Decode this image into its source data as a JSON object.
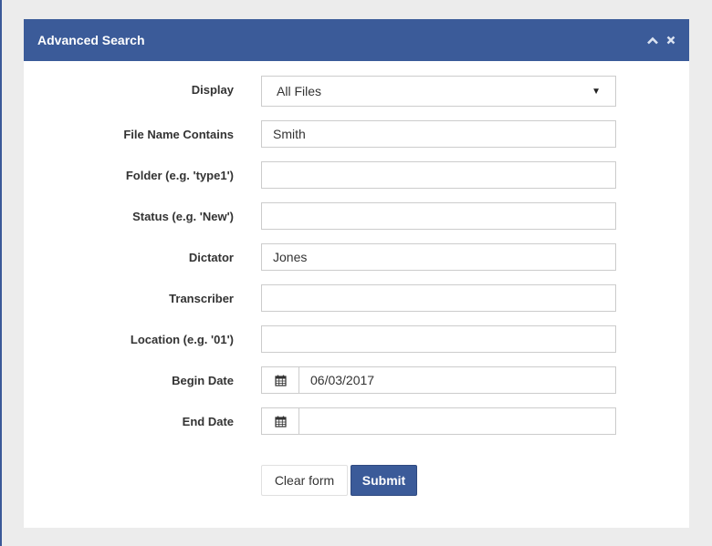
{
  "panel": {
    "title": "Advanced Search"
  },
  "fields": {
    "display": {
      "label": "Display",
      "value": "All Files"
    },
    "file_name": {
      "label": "File Name Contains",
      "value": "Smith"
    },
    "folder": {
      "label": "Folder (e.g. 'type1')",
      "value": ""
    },
    "status": {
      "label": "Status (e.g. 'New')",
      "value": ""
    },
    "dictator": {
      "label": "Dictator",
      "value": "Jones"
    },
    "transcriber": {
      "label": "Transcriber",
      "value": ""
    },
    "location": {
      "label": "Location (e.g. '01')",
      "value": ""
    },
    "begin_date": {
      "label": "Begin Date",
      "value": "06/03/2017"
    },
    "end_date": {
      "label": "End Date",
      "value": ""
    }
  },
  "buttons": {
    "clear_label": "Clear form",
    "submit_label": "Submit"
  },
  "icons": {
    "collapse": "chevron-up-icon",
    "close": "close-icon",
    "calendar": "calendar-icon"
  },
  "colors": {
    "accent": "#3b5b99",
    "background": "#ececec"
  }
}
